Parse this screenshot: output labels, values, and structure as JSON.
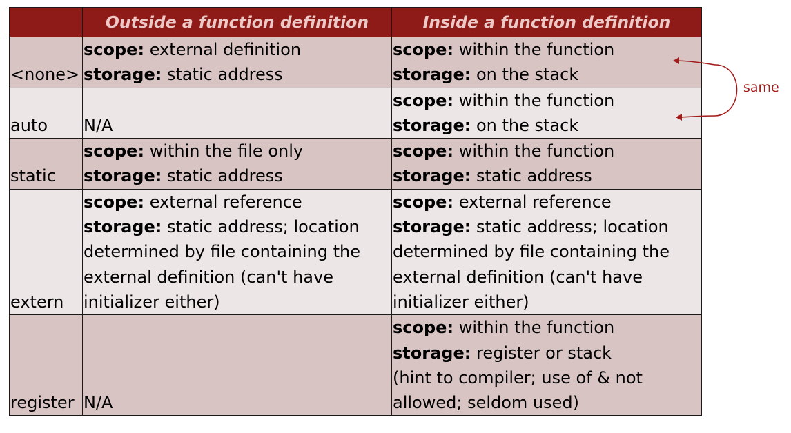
{
  "table": {
    "headers": {
      "corner": "",
      "outside": "Outside a function definition",
      "inside": "Inside a function definition"
    },
    "rows": [
      {
        "keyword": "<none>",
        "outside": [
          {
            "bold": "scope:",
            "text": " external definition"
          },
          {
            "bold": "storage:",
            "text": " static address"
          }
        ],
        "inside": [
          {
            "bold": "scope:",
            "text": " within the function"
          },
          {
            "bold": "storage:",
            "text": " on the stack"
          }
        ]
      },
      {
        "keyword": "auto",
        "outside": [
          {
            "bold": "",
            "text": "N/A"
          }
        ],
        "inside": [
          {
            "bold": "scope:",
            "text": " within the function"
          },
          {
            "bold": "storage:",
            "text": " on the stack"
          }
        ]
      },
      {
        "keyword": "static",
        "outside": [
          {
            "bold": "scope:",
            "text": " within the file only"
          },
          {
            "bold": "storage:",
            "text": " static address"
          }
        ],
        "inside": [
          {
            "bold": "scope:",
            "text": " within the function"
          },
          {
            "bold": "storage:",
            "text": " static address"
          }
        ]
      },
      {
        "keyword": "extern",
        "outside": [
          {
            "bold": "scope:",
            "text": " external reference"
          },
          {
            "bold": "storage:",
            "text": " static address; location"
          },
          {
            "bold": "",
            "text": "determined by file containing the"
          },
          {
            "bold": "",
            "text": "external definition (can't have"
          },
          {
            "bold": "",
            "text": "initializer either)"
          }
        ],
        "inside": [
          {
            "bold": "scope:",
            "text": " external reference"
          },
          {
            "bold": "storage:",
            "text": " static address; location"
          },
          {
            "bold": "",
            "text": "determined by file containing the"
          },
          {
            "bold": "",
            "text": "external definition (can't have"
          },
          {
            "bold": "",
            "text": "initializer either)"
          }
        ]
      },
      {
        "keyword": "register",
        "outside": [
          {
            "bold": "",
            "text": "N/A"
          }
        ],
        "inside": [
          {
            "bold": "scope:",
            "text": " within the function"
          },
          {
            "bold": "storage:",
            "text": " register or stack"
          },
          {
            "bold": "",
            "text": "(hint to compiler; use of & not"
          },
          {
            "bold": "",
            "text": "allowed; seldom used)"
          }
        ]
      }
    ]
  },
  "annotation": {
    "label": "same",
    "color": "#a11c1c"
  },
  "colors": {
    "header_bg": "#8e1b17",
    "header_text": "#ecc9c6",
    "row_dark": "#d9c4c4",
    "row_light": "#ede6e6"
  }
}
